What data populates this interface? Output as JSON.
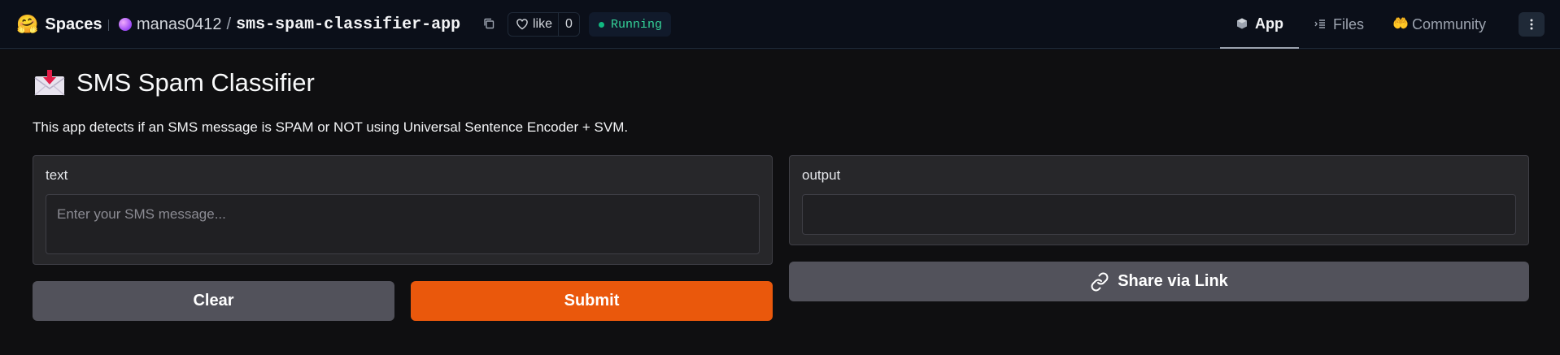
{
  "header": {
    "brand": "Spaces",
    "owner": "manas0412",
    "slash": "/",
    "repo_name": "sms-spam-classifier-app",
    "like_label": "like",
    "like_count": "0",
    "status": "Running",
    "nav": {
      "app": "App",
      "files": "Files",
      "community": "Community"
    }
  },
  "app": {
    "title": "SMS Spam Classifier",
    "description": "This app detects if an SMS message is SPAM or NOT using Universal Sentence Encoder + SVM.",
    "input_label": "text",
    "input_placeholder": "Enter your SMS message...",
    "output_label": "output",
    "output_value": "",
    "clear_label": "Clear",
    "submit_label": "Submit",
    "share_label": "Share via Link"
  },
  "colors": {
    "accent": "#ea580c",
    "status": "#10b981",
    "button_secondary": "#52525b"
  }
}
